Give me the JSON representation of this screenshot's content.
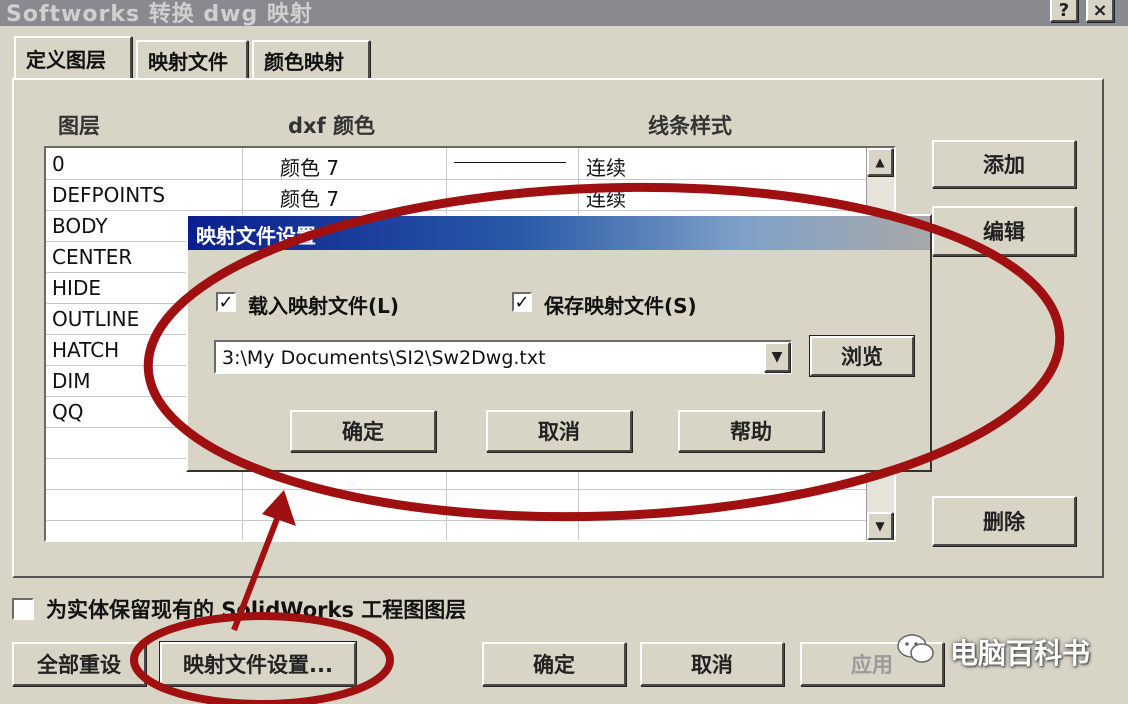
{
  "window": {
    "title": "Softworks 转换 dwg 映射",
    "help_btn": "?",
    "close_btn": "×"
  },
  "tabs": [
    "定义图层",
    "映射文件",
    "颜色映射"
  ],
  "list": {
    "headers": {
      "layer": "图层",
      "color": "dxf 颜色",
      "linetype": "线条样式"
    },
    "rows": [
      {
        "name": "0",
        "color": "颜色 7",
        "linetype": "连续"
      },
      {
        "name": "DEFPOINTS",
        "color": "颜色 7",
        "linetype": "连续"
      },
      {
        "name": "BODY",
        "color": "",
        "linetype": ""
      },
      {
        "name": "CENTER",
        "color": "",
        "linetype": ""
      },
      {
        "name": "HIDE",
        "color": "",
        "linetype": ""
      },
      {
        "name": "OUTLINE",
        "color": "",
        "linetype": ""
      },
      {
        "name": "HATCH",
        "color": "",
        "linetype": ""
      },
      {
        "name": "DIM",
        "color": "",
        "linetype": ""
      },
      {
        "name": "QQ",
        "color": "",
        "linetype": ""
      }
    ],
    "scroll_up": "▲",
    "scroll_down": "▼"
  },
  "side_buttons": {
    "add": "添加",
    "edit": "编辑",
    "delete": "删除"
  },
  "dialog": {
    "title": "映射文件设置",
    "load_label": "载入映射文件(L)",
    "save_label": "保存映射文件(S)",
    "load_checked": true,
    "save_checked": true,
    "check_mark": "✓",
    "path_value": "3:\\My Documents\\SI2\\Sw2Dwg.txt",
    "combo_arrow": "▼",
    "browse": "浏览",
    "ok": "确定",
    "cancel": "取消",
    "help": "帮助"
  },
  "bottom": {
    "checkbox_label": "为实体保留现有的 SolidWorks 工程图图层",
    "reset_all": "全部重设",
    "mapping_settings": "映射文件设置...",
    "ok": "确定",
    "cancel": "取消",
    "apply": "应用"
  },
  "watermark": {
    "text": "电脑百科书",
    "icon": "wechat-icon"
  },
  "colors": {
    "highlight": "#a01010",
    "dialog_title": "#0a1f8f"
  }
}
